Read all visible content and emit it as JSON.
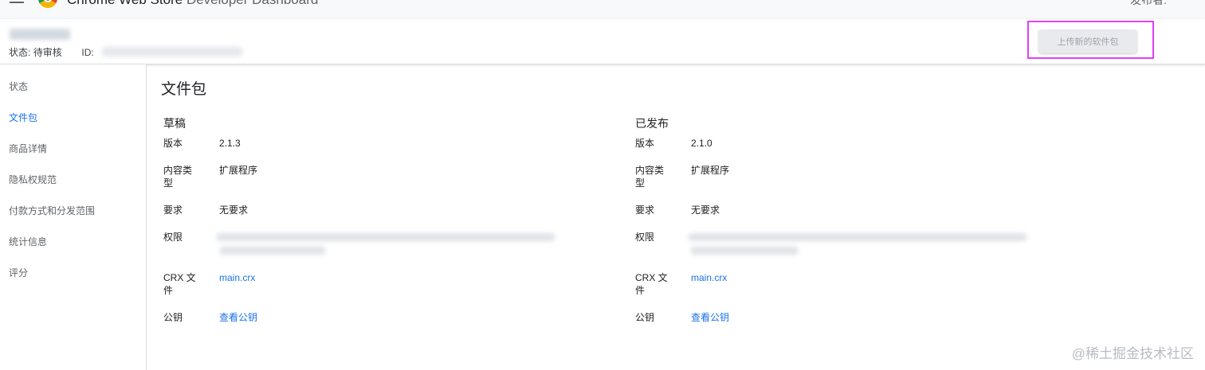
{
  "app": {
    "title_main": "Chrome Web Store",
    "title_sub": "Developer Dashboard",
    "top_right": "发布者:"
  },
  "header": {
    "status_label": "状态:",
    "status_value": "待审核",
    "id_label": "ID:",
    "upload_button": "上传新的软件包"
  },
  "sidebar": {
    "items": [
      {
        "label": "状态",
        "active": false
      },
      {
        "label": "文件包",
        "active": true
      },
      {
        "label": "商品详情",
        "active": false
      },
      {
        "label": "隐私权规范",
        "active": false
      },
      {
        "label": "付款方式和分发范围",
        "active": false
      },
      {
        "label": "统计信息",
        "active": false
      },
      {
        "label": "评分",
        "active": false
      }
    ]
  },
  "main": {
    "title": "文件包",
    "draft": {
      "heading": "草稿",
      "version_label": "版本",
      "version_value": "2.1.3",
      "content_type_label": "内容类型",
      "content_type_value": "扩展程序",
      "requirements_label": "要求",
      "requirements_value": "无要求",
      "permissions_label": "权限",
      "crx_label": "CRX 文件",
      "crx_value": "main.crx",
      "public_key_label": "公钥",
      "public_key_value": "查看公钥"
    },
    "published": {
      "heading": "已发布",
      "version_label": "版本",
      "version_value": "2.1.0",
      "content_type_label": "内容类型",
      "content_type_value": "扩展程序",
      "requirements_label": "要求",
      "requirements_value": "无要求",
      "permissions_label": "权限",
      "crx_label": "CRX 文件",
      "crx_value": "main.crx",
      "public_key_label": "公钥",
      "public_key_value": "查看公钥"
    }
  },
  "watermark": "@稀土掘金技术社区",
  "colors": {
    "accent": "#1a73e8",
    "highlight": "#e040fb"
  }
}
